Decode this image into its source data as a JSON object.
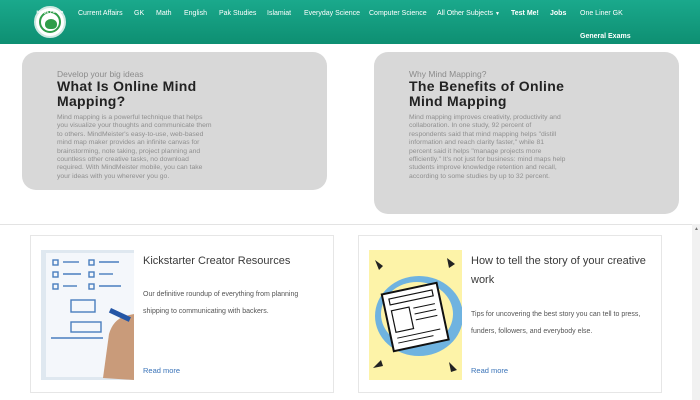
{
  "site": {
    "logo_text": "MCQs Forum"
  },
  "nav": {
    "items": [
      "Current Affairs",
      "GK",
      "Math",
      "English",
      "Pak Studies",
      "Islamiat",
      "Everyday Science",
      "Computer Science",
      "All Other Subjects",
      "Test Me!",
      "Jobs",
      "One Liner GK"
    ],
    "row2": "General Exams"
  },
  "mind_mapping": {
    "left": {
      "kicker": "Develop your big ideas",
      "title_line1": "What Is Online Mind",
      "title_line2": "Mapping?",
      "text": [
        "Mind mapping is a powerful technique that helps",
        "you visualize your thoughts and communicate them",
        "to others. MindMeister's easy-to-use, web-based",
        "mind map maker provides an infinite canvas for",
        "brainstorming, note taking, project planning and",
        "countless other creative tasks, no download",
        "required. With MindMeister mobile, you can take",
        "your ideas with you wherever you go."
      ]
    },
    "right": {
      "kicker": "Why Mind Mapping?",
      "title_line1": "The Benefits of Online",
      "title_line2": "Mind Mapping",
      "text": [
        "Mind mapping improves creativity, productivity and",
        "collaboration. In one study, 92 percent of",
        "respondents said that mind mapping helps \"distill",
        "information and reach clarity faster,\" while 81",
        "percent said it helps \"manage projects more",
        "efficiently.\" It's not just for business: mind maps help",
        "students improve knowledge retention and recall,",
        "according to some studies by up to 32 percent."
      ]
    }
  },
  "cards": [
    {
      "title": "Kickstarter Creator Resources",
      "desc_line1": "Our definitive roundup of everything from planning",
      "desc_line2": "shipping to communicating with backers.",
      "link": "Read more"
    },
    {
      "title_line1": "How to tell the story of your creative",
      "title_line2": "work",
      "desc_line1": "Tips for uncovering the best story you can tell to press,",
      "desc_line2": "funders, followers, and everybody else.",
      "link": "Read more"
    }
  ]
}
